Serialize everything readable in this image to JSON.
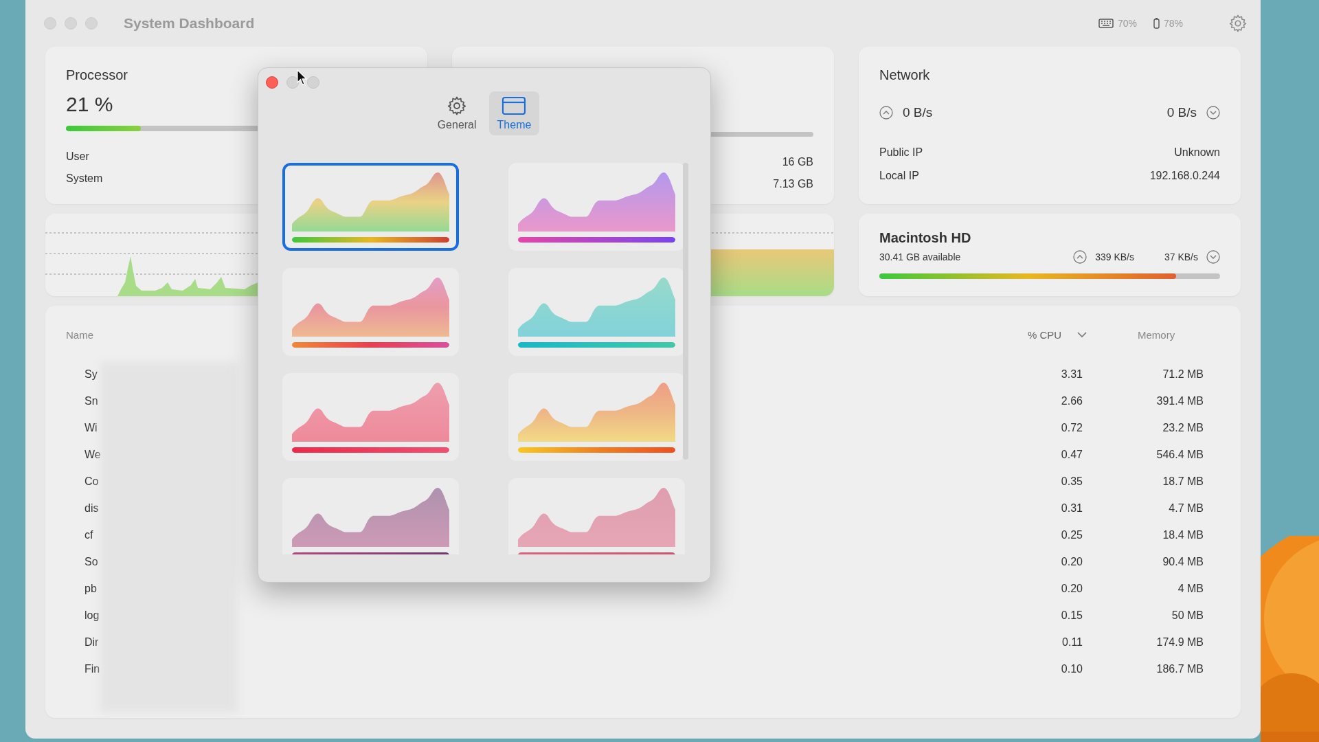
{
  "window": {
    "title": "System Dashboard"
  },
  "status": [
    {
      "kind": "keyboard",
      "reading": "70%"
    },
    {
      "kind": "battery",
      "reading": "78%"
    }
  ],
  "processor": {
    "title": "Processor",
    "usage": "21 %",
    "level": 0.22,
    "rows": [
      {
        "label": "User"
      },
      {
        "label": "System"
      }
    ]
  },
  "memory": {
    "values": [
      "16 GB",
      "7.13 GB"
    ]
  },
  "network": {
    "title": "Network",
    "upload": "0 B/s",
    "download": "0 B/s",
    "rows": [
      {
        "label": "Public IP",
        "value": "Unknown"
      },
      {
        "label": "Local IP",
        "value": "192.168.0.244"
      }
    ]
  },
  "disk": {
    "title": "Macintosh HD",
    "available": "30.41 GB available",
    "read": "339 KB/s",
    "write": "37 KB/s",
    "level": 0.87
  },
  "processes": {
    "columns": [
      {
        "label": "Name",
        "sorted": false
      },
      {
        "label": "% CPU",
        "sorted": true
      },
      {
        "label": "Memory",
        "sorted": false
      }
    ],
    "rows": [
      {
        "name": "Sy",
        "cpu": "3.31",
        "memory": "71.2 MB"
      },
      {
        "name": "Sn",
        "cpu": "2.66",
        "memory": "391.4 MB"
      },
      {
        "name": "Wi",
        "cpu": "0.72",
        "memory": "23.2 MB"
      },
      {
        "name": "We",
        "cpu": "0.47",
        "memory": "546.4 MB"
      },
      {
        "name": "Co",
        "cpu": "0.35",
        "memory": "18.7 MB"
      },
      {
        "name": "dis",
        "cpu": "0.31",
        "memory": "4.7 MB"
      },
      {
        "name": "cf",
        "cpu": "0.25",
        "memory": "18.4 MB"
      },
      {
        "name": "So",
        "cpu": "0.20",
        "memory": "90.4 MB"
      },
      {
        "name": "pb",
        "cpu": "0.20",
        "memory": "4 MB"
      },
      {
        "name": "log",
        "cpu": "0.15",
        "memory": "50 MB"
      },
      {
        "name": "Dir",
        "cpu": "0.11",
        "memory": "174.9 MB"
      },
      {
        "name": "Fin",
        "cpu": "0.10",
        "memory": "186.7 MB"
      }
    ]
  },
  "settings": {
    "tabs": [
      {
        "label": "General",
        "kind": "gear",
        "selected": false
      },
      {
        "label": "Theme",
        "kind": "window",
        "selected": true
      }
    ],
    "themes": [
      {
        "selected": true
      },
      {
        "selected": false
      },
      {
        "selected": false
      },
      {
        "selected": false
      },
      {
        "selected": false
      },
      {
        "selected": false
      },
      {
        "selected": false
      },
      {
        "selected": false
      }
    ]
  }
}
